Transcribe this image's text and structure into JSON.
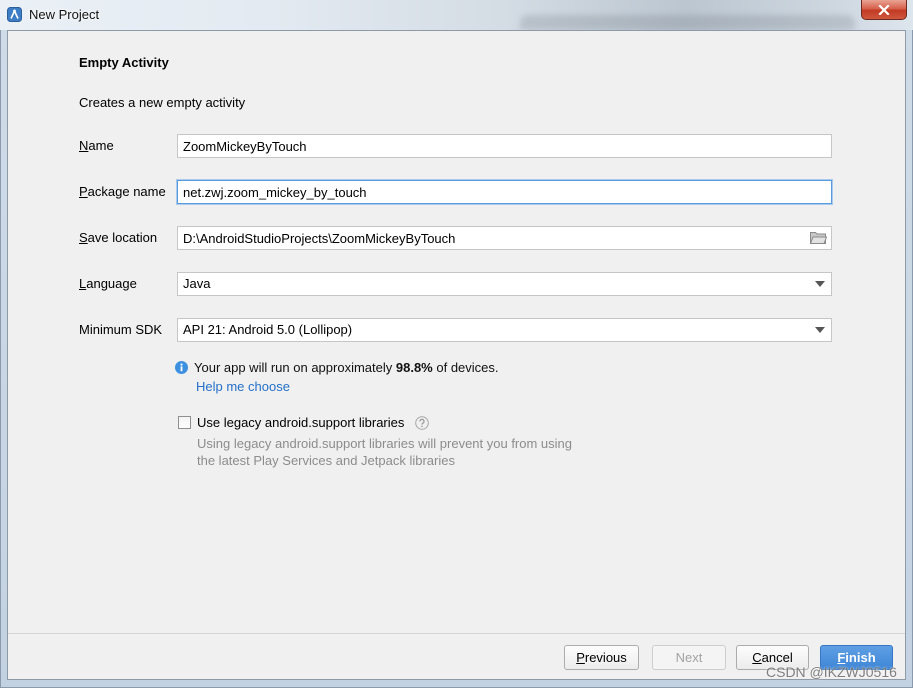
{
  "window": {
    "title": "New Project",
    "title_icon": "android-studio-icon",
    "close_icon": "close-icon"
  },
  "header": {
    "title": "Empty Activity",
    "description": "Creates a new empty activity"
  },
  "form": {
    "name": {
      "label": "Name",
      "value": "ZoomMickeyByTouch"
    },
    "package_name": {
      "label": "Package name",
      "value": "net.zwj.zoom_mickey_by_touch",
      "focused": true
    },
    "save_location": {
      "label": "Save location",
      "value": "D:\\AndroidStudioProjects\\ZoomMickeyByTouch",
      "icon": "folder-icon"
    },
    "language": {
      "label": "Language",
      "value": "Java",
      "icon": "chevron-down-icon"
    },
    "minimum_sdk": {
      "label": "Minimum SDK",
      "value": "API 21: Android 5.0 (Lollipop)",
      "icon": "chevron-down-icon"
    }
  },
  "sdk_info": {
    "icon": "info-icon",
    "text_before": "Your app will run on approximately",
    "percentage": "98.8%",
    "text_after": "of devices.",
    "help_link": "Help me choose"
  },
  "legacy_support": {
    "checked": false,
    "label": "Use legacy android.support libraries",
    "help_icon": "question-circle-icon",
    "description_lines": [
      "Using legacy android.support libraries will prevent you from using",
      "the latest Play Services and Jetpack libraries"
    ]
  },
  "buttons": {
    "previous": {
      "label": "Previous",
      "enabled": true
    },
    "next": {
      "label": "Next",
      "enabled": false
    },
    "cancel": {
      "label": "Cancel",
      "enabled": true
    },
    "finish": {
      "label": "Finish",
      "enabled": true
    }
  },
  "watermark": "CSDN @IKZWJ0516",
  "colors": {
    "accent": "#3f86d6",
    "link": "#2470c9",
    "info": "#3d8fe0",
    "muted_text": "#8c8c8c",
    "focus_border": "#5a9be0"
  }
}
